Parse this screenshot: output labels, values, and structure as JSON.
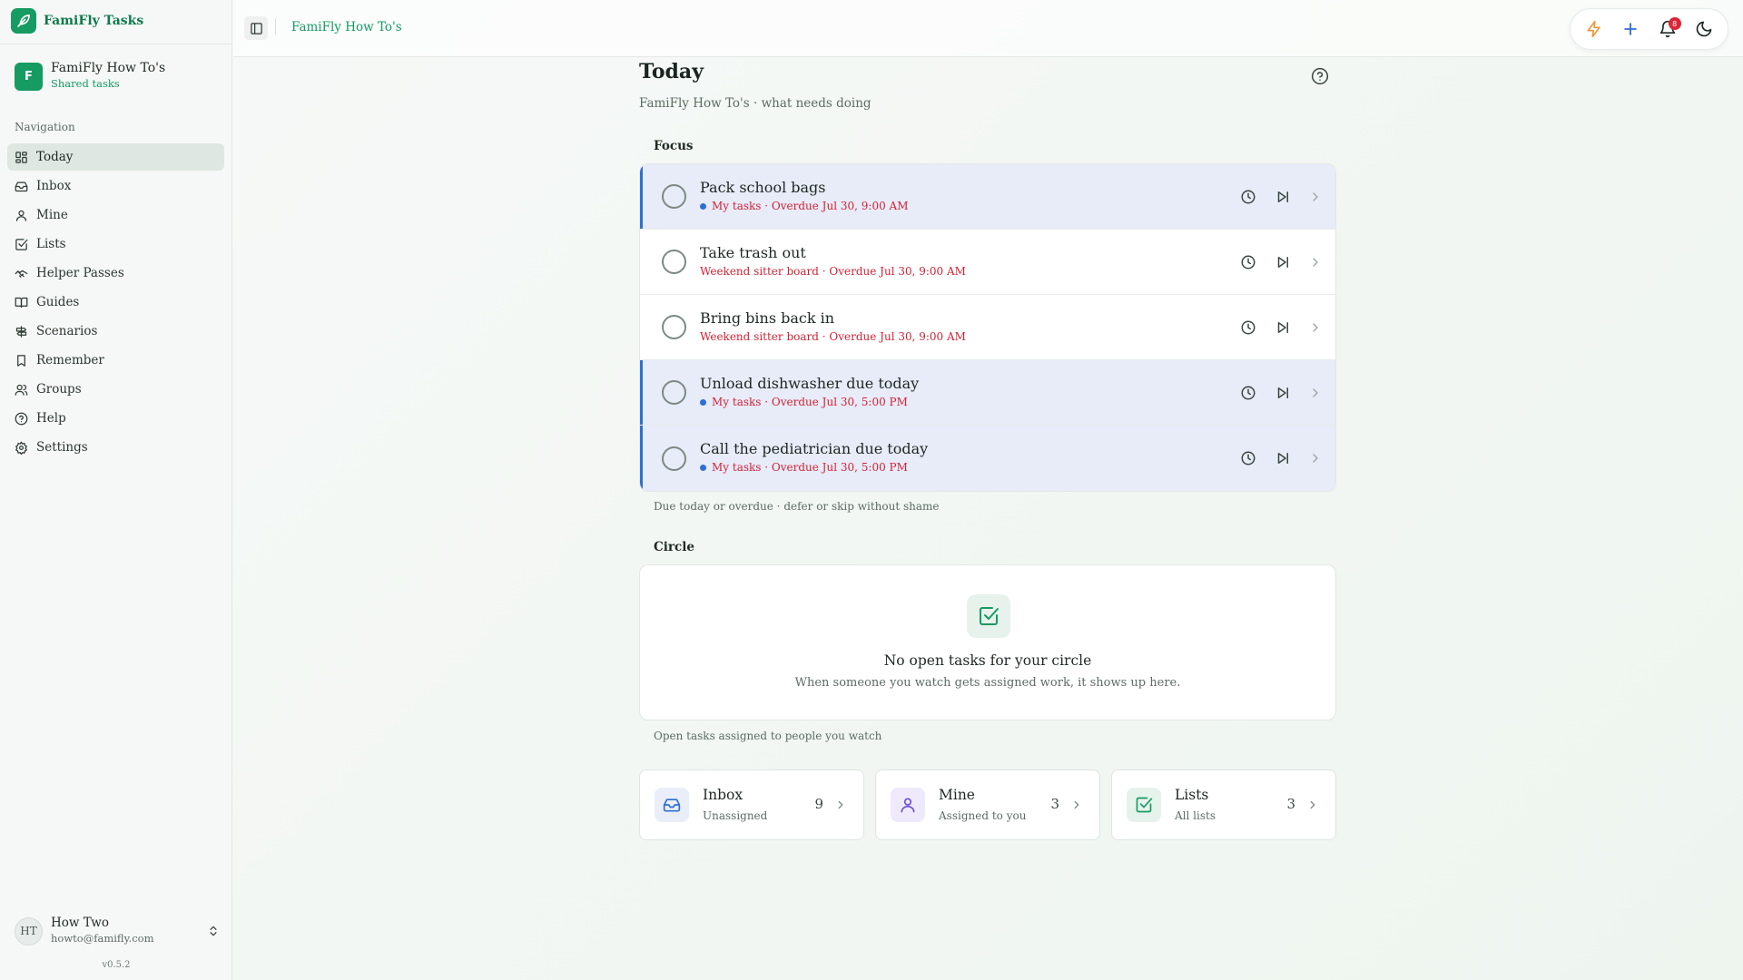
{
  "brand": {
    "name": "FamiFly Tasks"
  },
  "workspace": {
    "badge": "F",
    "name": "FamiFly How To's",
    "subtitle": "Shared tasks"
  },
  "nav": {
    "heading": "Navigation",
    "items": [
      {
        "label": "Today",
        "icon": "grid-icon",
        "active": true
      },
      {
        "label": "Inbox",
        "icon": "inbox-icon"
      },
      {
        "label": "Mine",
        "icon": "user-icon"
      },
      {
        "label": "Lists",
        "icon": "checkbox-icon"
      },
      {
        "label": "Helper Passes",
        "icon": "handshake-icon"
      },
      {
        "label": "Guides",
        "icon": "book-icon"
      },
      {
        "label": "Scenarios",
        "icon": "signpost-icon"
      },
      {
        "label": "Remember",
        "icon": "bookmark-icon"
      },
      {
        "label": "Groups",
        "icon": "users-icon"
      },
      {
        "label": "Help",
        "icon": "help-circle-icon"
      },
      {
        "label": "Settings",
        "icon": "gear-icon"
      }
    ]
  },
  "user": {
    "initials": "HT",
    "name": "How Two",
    "email": "howto@famifly.com"
  },
  "version": "v0.5.2",
  "topbar": {
    "breadcrumb": "FamiFly How To's",
    "notification_count": "8"
  },
  "page": {
    "title": "Today",
    "subtitle": "FamiFly How To's · what needs doing"
  },
  "focus": {
    "heading": "Focus",
    "caption": "Due today or overdue · defer or skip without shame",
    "tasks": [
      {
        "title": "Pack school bags",
        "meta": "My tasks · Overdue Jul 30, 9:00 AM",
        "mine": true
      },
      {
        "title": "Take trash out",
        "meta": "Weekend sitter board · Overdue Jul 30, 9:00 AM",
        "mine": false
      },
      {
        "title": "Bring bins back in",
        "meta": "Weekend sitter board · Overdue Jul 30, 9:00 AM",
        "mine": false
      },
      {
        "title": "Unload dishwasher due today",
        "meta": "My tasks · Overdue Jul 30, 5:00 PM",
        "mine": true
      },
      {
        "title": "Call the pediatrician due today",
        "meta": "My tasks · Overdue Jul 30, 5:00 PM",
        "mine": true
      }
    ]
  },
  "circle": {
    "heading": "Circle",
    "empty_title": "No open tasks for your circle",
    "empty_text": "When someone you watch gets assigned work, it shows up here.",
    "caption": "Open tasks assigned to people you watch"
  },
  "tiles": [
    {
      "title": "Inbox",
      "subtitle": "Unassigned",
      "count": "9",
      "icon": "inbox-icon",
      "color": "#2f6fd1",
      "bg": "#e9eef8"
    },
    {
      "title": "Mine",
      "subtitle": "Assigned to you",
      "count": "3",
      "icon": "user-icon",
      "color": "#6d4fd1",
      "bg": "#efeafb"
    },
    {
      "title": "Lists",
      "subtitle": "All lists",
      "count": "3",
      "icon": "checkbox-icon",
      "color": "#169b62",
      "bg": "#e6f3ec"
    }
  ],
  "colors": {
    "accent": "#169b62",
    "overdue": "#d02336",
    "mine_marker": "#2f6fd1",
    "mine_row_bg": "#e8ebf8"
  }
}
